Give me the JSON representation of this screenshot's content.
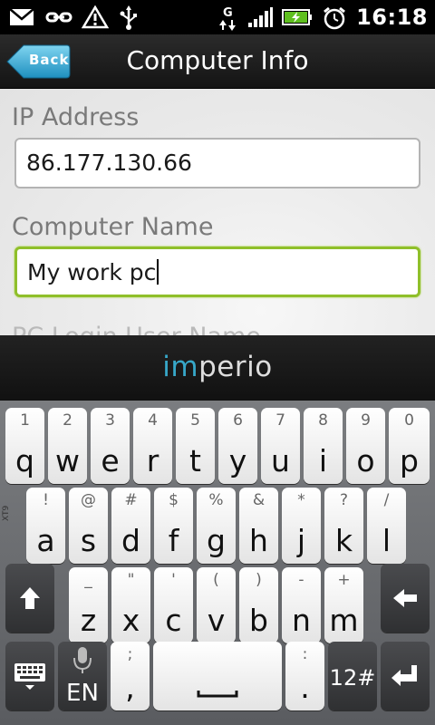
{
  "status_bar": {
    "time": "16:18",
    "icons": [
      "mail-icon",
      "usb-tether-icon",
      "warning-icon",
      "usb-icon",
      "gprs-icon",
      "signal-icon",
      "battery-charging-icon",
      "alarm-clock-icon"
    ],
    "network_type": "G"
  },
  "title_bar": {
    "back_label": "Back",
    "title": "Computer Info"
  },
  "form": {
    "ip_label": "IP Address",
    "ip_value": "86.177.130.66",
    "name_label": "Computer Name",
    "name_value": "My work pc",
    "next_label_partial": "PC Login User Name"
  },
  "ime_bar": {
    "logo_prefix": "i",
    "logo_m": "m",
    "logo_rest": "perio"
  },
  "keyboard": {
    "row1": [
      {
        "num": "1",
        "ch": "q"
      },
      {
        "num": "2",
        "ch": "w"
      },
      {
        "num": "3",
        "ch": "e"
      },
      {
        "num": "4",
        "ch": "r"
      },
      {
        "num": "5",
        "ch": "t"
      },
      {
        "num": "6",
        "ch": "y"
      },
      {
        "num": "7",
        "ch": "u"
      },
      {
        "num": "8",
        "ch": "i"
      },
      {
        "num": "9",
        "ch": "o"
      },
      {
        "num": "0",
        "ch": "p"
      }
    ],
    "row2": [
      {
        "num": "!",
        "ch": "a"
      },
      {
        "num": "@",
        "ch": "s"
      },
      {
        "num": "#",
        "ch": "d"
      },
      {
        "num": "$",
        "ch": "f"
      },
      {
        "num": "%",
        "ch": "g"
      },
      {
        "num": "&",
        "ch": "h"
      },
      {
        "num": "*",
        "ch": "j"
      },
      {
        "num": "?",
        "ch": "k"
      },
      {
        "num": "/",
        "ch": "l"
      }
    ],
    "row3": [
      {
        "num": "_",
        "ch": "z"
      },
      {
        "num": "\"",
        "ch": "x"
      },
      {
        "num": "'",
        "ch": "c"
      },
      {
        "num": "(",
        "ch": "v"
      },
      {
        "num": ")",
        "ch": "b"
      },
      {
        "num": "-",
        "ch": "n"
      },
      {
        "num": "+",
        "ch": "m"
      }
    ],
    "lang_label": "EN",
    "comma_top": ";",
    "comma_char": ",",
    "period_top": ":",
    "period_char": ".",
    "symbols_label": "12#",
    "side_label": "XT9",
    "colors": {
      "key_face": "#f4f4f4",
      "key_dark": "#3a3b3e",
      "focus_border": "#8fbf2a",
      "imperio_accent": "#37a7c8"
    }
  }
}
